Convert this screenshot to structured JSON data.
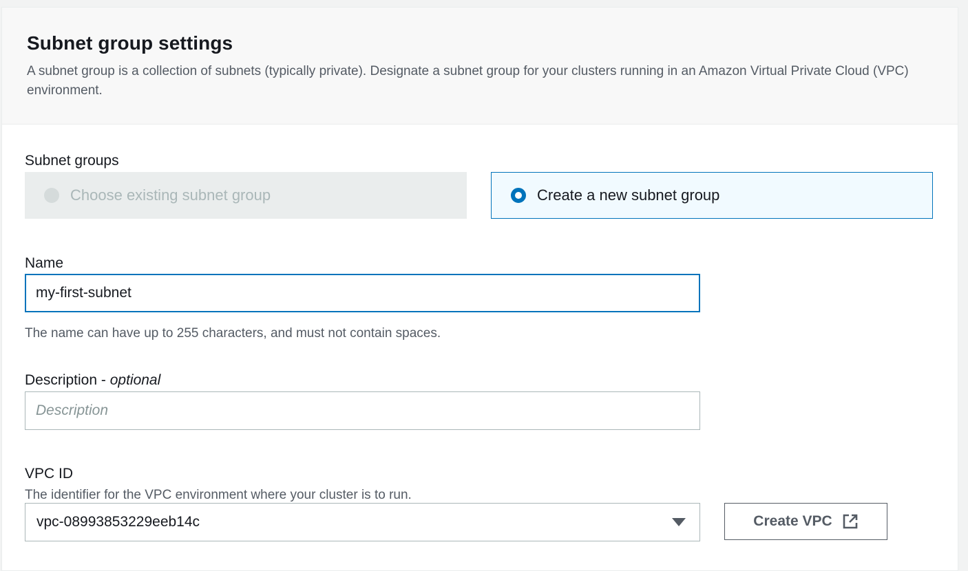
{
  "section": {
    "title": "Subnet group settings",
    "description": "A subnet group is a collection of subnets (typically private). Designate a subnet group for your clusters running in an Amazon Virtual Private Cloud (VPC) environment."
  },
  "subnet_groups": {
    "label": "Subnet groups",
    "options": [
      {
        "label": "Choose existing subnet group",
        "state": "disabled"
      },
      {
        "label": "Create a new subnet group",
        "state": "selected"
      }
    ]
  },
  "name_field": {
    "label": "Name",
    "value": "my-first-subnet",
    "hint": "The name can have up to 255 characters, and must not contain spaces."
  },
  "description_field": {
    "label": "Description",
    "optional_marker": "optional",
    "separator": " - ",
    "placeholder": "Description",
    "value": ""
  },
  "vpc_field": {
    "label": "VPC ID",
    "hint": "The identifier for the VPC environment where your cluster is to run.",
    "selected_value": "vpc-08993853229eeb14c",
    "dropdown_icon": "caret-down-icon"
  },
  "create_vpc_button": {
    "label": "Create VPC",
    "icon": "external-link-icon"
  },
  "colors": {
    "accent": "#0073bb",
    "selected_tile_bg": "#f1faff",
    "disabled_tile_bg": "#eaeded",
    "header_bg": "#f8f8f8"
  }
}
